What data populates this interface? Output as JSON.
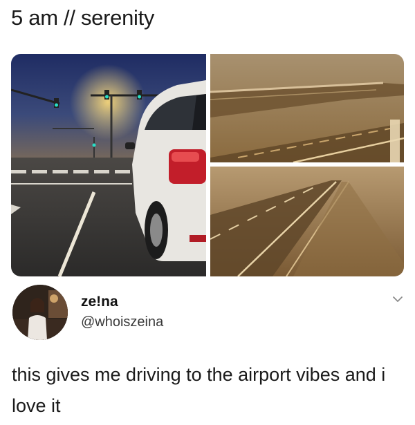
{
  "header": {
    "caption": "5 am // serenity"
  },
  "media": {
    "photos": [
      {
        "description_icon": "car-at-intersection-photo"
      },
      {
        "description_icon": "foggy-bridge-photo"
      },
      {
        "description_icon": "foggy-highway-photo"
      }
    ]
  },
  "post": {
    "display_name": "ze!na",
    "handle": "@whoiszeina",
    "body": "this gives me driving to the airport vibes and i love it",
    "menu_icon": "chevron-down-icon"
  },
  "colors": {
    "fog_amber": "#b5874a",
    "night_sky": "#2b3d78",
    "text": "#1a1a1a"
  }
}
